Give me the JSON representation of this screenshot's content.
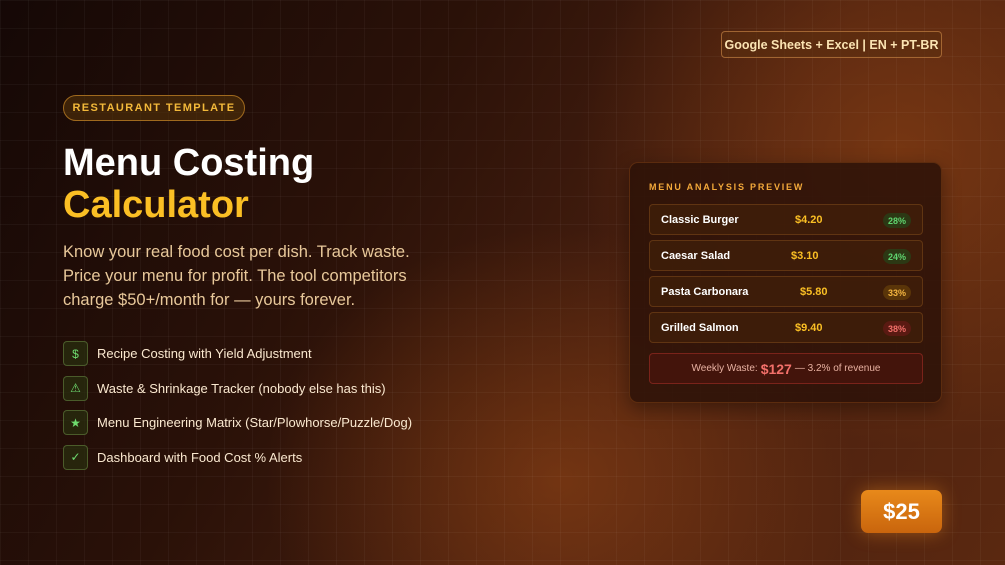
{
  "top_badge": "Google Sheets + Excel | EN + PT-BR",
  "pill": "RESTAURANT TEMPLATE",
  "title": {
    "line1": "Menu Costing",
    "line2": "Calculator"
  },
  "subtitle": "Know your real food cost per dish. Track waste. Price your menu for profit. The tool competitors charge $50+/month for — yours forever.",
  "features": [
    {
      "icon": "dollar-icon",
      "glyph": "$",
      "label": "Recipe Costing with Yield Adjustment"
    },
    {
      "icon": "warning-icon",
      "glyph": "⚠",
      "label": "Waste & Shrinkage Tracker (nobody else has this)"
    },
    {
      "icon": "star-icon",
      "glyph": "★",
      "label": "Menu Engineering Matrix (Star/Plowhorse/Puzzle/Dog)"
    },
    {
      "icon": "check-icon",
      "glyph": "✓",
      "label": "Dashboard with Food Cost % Alerts"
    }
  ],
  "preview": {
    "title": "MENU ANALYSIS PREVIEW",
    "rows": [
      {
        "dish": "Classic Burger",
        "cost": "$4.20",
        "pct": "28%"
      },
      {
        "dish": "Caesar Salad",
        "cost": "$3.10",
        "pct": "24%"
      },
      {
        "dish": "Pasta Carbonara",
        "cost": "$5.80",
        "pct": "33%"
      },
      {
        "dish": "Grilled Salmon",
        "cost": "$9.40",
        "pct": "38%"
      }
    ],
    "waste": {
      "label": "Weekly Waste:",
      "amount": "$127",
      "note": "— 3.2% of revenue"
    }
  },
  "price": "$25",
  "colors": {
    "accent": "#fbbf24",
    "good": "#5fd56f",
    "warn": "#f3b540",
    "bad": "#f2706a",
    "price_button": "#e8891a"
  }
}
